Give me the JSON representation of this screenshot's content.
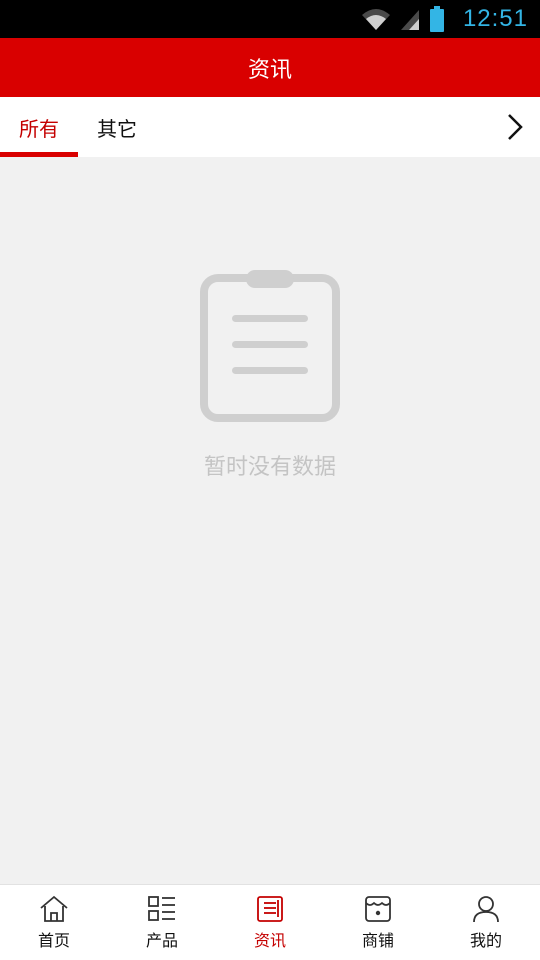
{
  "status_bar": {
    "time": "12:51",
    "icons": [
      "wifi-icon",
      "signal-icon",
      "battery-icon"
    ],
    "color": "#33b5e5"
  },
  "header": {
    "title": "资讯",
    "background": "#d90000"
  },
  "tabs": {
    "items": [
      {
        "label": "所有",
        "active": true
      },
      {
        "label": "其它",
        "active": false
      }
    ],
    "more_icon": "chevron-right-icon"
  },
  "empty_state": {
    "icon": "clipboard-icon",
    "message": "暂时没有数据"
  },
  "bottom_nav": {
    "items": [
      {
        "label": "首页",
        "icon": "home-icon",
        "active": false
      },
      {
        "label": "产品",
        "icon": "grid-list-icon",
        "active": false
      },
      {
        "label": "资讯",
        "icon": "news-icon",
        "active": true
      },
      {
        "label": "商铺",
        "icon": "shop-icon",
        "active": false
      },
      {
        "label": "我的",
        "icon": "user-icon",
        "active": false
      }
    ],
    "active_color": "#c40000"
  }
}
